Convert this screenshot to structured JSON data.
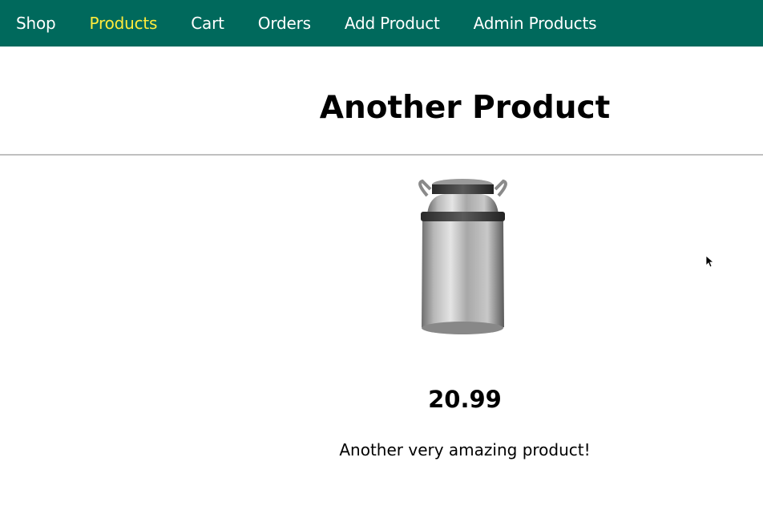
{
  "nav": {
    "items": [
      {
        "label": "Shop",
        "active": false
      },
      {
        "label": "Products",
        "active": true
      },
      {
        "label": "Cart",
        "active": false
      },
      {
        "label": "Orders",
        "active": false
      },
      {
        "label": "Add Product",
        "active": false
      },
      {
        "label": "Admin Products",
        "active": false
      }
    ]
  },
  "product": {
    "title": "Another Product",
    "price": "20.99",
    "description": "Another very amazing product!",
    "image_icon": "milk-can-image"
  },
  "colors": {
    "nav_background": "#00695c",
    "nav_active": "#ffeb3b",
    "nav_text": "#ffffff"
  }
}
